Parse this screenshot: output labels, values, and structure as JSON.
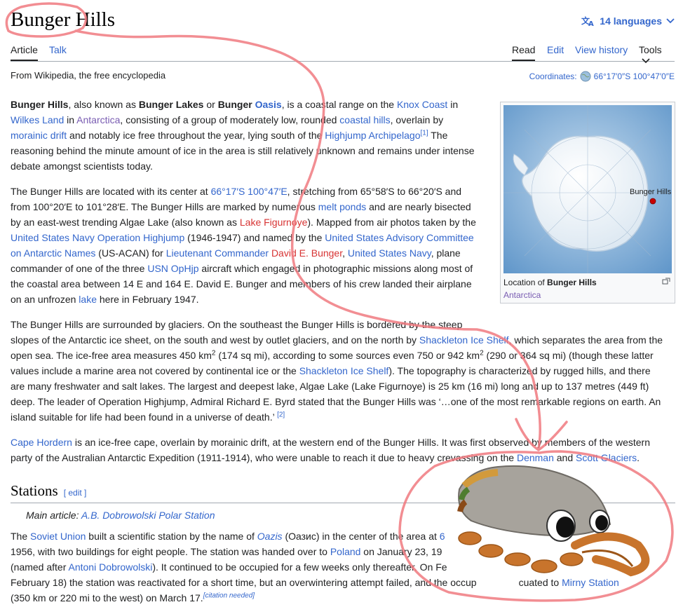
{
  "page": {
    "title": "Bunger Hills",
    "languages": "14 languages",
    "tabs_left": [
      "Article",
      "Talk"
    ],
    "tabs_right": [
      "Read",
      "Edit",
      "View history",
      "Tools"
    ],
    "from": "From Wikipedia, the free encyclopedia",
    "coords_label": "Coordinates:",
    "coords_value": "66°17′0″S 100°47′0″E"
  },
  "p1": {
    "b1": "Bunger Hills",
    "t1": ", also known as ",
    "b2": "Bunger Lakes",
    "t2": " or ",
    "b3": "Bunger ",
    "l_oasis": "Oasis",
    "t3": ", is a coastal range on the ",
    "l_knox": "Knox Coast",
    "t4": " in",
    "l_wilkes": "Wilkes Land",
    "t5": " in ",
    "l_antarctica": "Antarctica",
    "t6": ", consisting of a group of moderately low, rounded ",
    "l_coastal": "coastal hills",
    "t7": ", overlain by",
    "l_morainic": "morainic drift",
    "t8": " and notably ice free throughout the year, lying south of the ",
    "l_highjump": "Highjump Archipelago",
    "ref1": "[1]",
    "t9": " The",
    "line4": "reasoning behind the minute amount of ice in the area is still relatively unknown and remains under intense",
    "line5": "debate amongst scientists today."
  },
  "p2": {
    "t1": "The Bunger Hills are located with its center at ",
    "l_coord": "66°17′S 100°47′E",
    "t2": ", stretching from 65°58′S to 66°20′S and",
    "t3": "from 100°20′E to 101°28′E. The Bunger Hills are marked by numerous ",
    "l_melt": "melt ponds",
    "t4": " and are nearly bisected",
    "t5": "by an east-west trending Algae Lake (also known as ",
    "l_figurnoye": "Lake Figurnoye",
    "t6": "). Mapped from air photos taken by the",
    "l_usn": "United States Navy Operation Highjump",
    "t7": " (1946-1947) and named by the ",
    "l_usacan": "United States Advisory Committee",
    "l_usacan2": "on Antarctic Names",
    "t8": " (US-ACAN) for ",
    "l_ltcdr": "Lieutenant Commander",
    "t9": " ",
    "l_bunger": "David E. Bunger",
    "t10": ", ",
    "l_navy": "United States Navy",
    "t11": ", plane",
    "t12": "commander of one of the three ",
    "l_usnophjp": "USN OpHjp",
    "t13": " aircraft which engaged in photographic missions along most of",
    "line7": "the coastal area between 14 E and 164 E. David E. Bunger and members of his crew landed their airplane",
    "t14": "on an unfrozen ",
    "l_lake": "lake",
    "t15": " here in February 1947."
  },
  "p3": {
    "line1": "The Bunger Hills are surrounded by glaciers. On the southeast the Bunger Hills is bordered by the steep",
    "t1": "slopes of the Antarctic ice sheet, on the south and west by outlet glaciers, and on the north by ",
    "l_shackleton": "Shackleton Ice Shelf",
    "t2": ", which separates the area from the",
    "t3": "open sea. The ice-free area measures 450 km",
    "sup2": "2",
    "t4": " (174 sq mi), according to some sources even 750 or 942 km",
    "sup2b": "2",
    "t5": " (290 or 364 sq mi) (though these latter",
    "t6": "values include a marine area not covered by continental ice or the ",
    "l_shackleton2": "Shackleton Ice Shelf",
    "t7": "). The topography is characterized by rugged hills, and there",
    "line5": "are many freshwater and salt lakes. The largest and deepest lake, Algae Lake (Lake Figurnoye) is 25 km (16 mi) long and up to 137 metres (449 ft)",
    "line6": "deep. The leader of Operation Highjump, Admiral Richard E. Byrd stated that the Bunger Hills was ‘…one of the most remarkable regions on earth. An",
    "t8": "island suitable for life had been found in a universe of death.’ ",
    "ref2": "[2]"
  },
  "p4": {
    "l_cape": "Cape Hordern",
    "t1": " is an ice-free cape, overlain by morainic drift, at the western end of the Bunger Hills. It was first observed by members of the western",
    "t2": "party of the Australian Antarctic Expedition (1911-1914), who were unable to reach it due to heavy crevassing on the ",
    "l_denman": "Denman",
    "t3": " and ",
    "l_scott": "Scott Glaciers",
    "t4": "."
  },
  "stations": {
    "heading": "Stations",
    "edit": "[ edit ]",
    "hat_main": "Main article: ",
    "hat_link": "A.B. Dobrowolski Polar Station"
  },
  "p5": {
    "t1": "The ",
    "l_soviet": "Soviet Union",
    "t2": " built a scientific station by the name of ",
    "l_oazis": "Oazis",
    "t3": " (Оазис) in the center of the area at ",
    "l_6": "6",
    "t4": "1956, with two buildings for eight people. The station was handed over to ",
    "l_poland": "Poland",
    "t5": " on January 23, 19",
    "t6": "(named after ",
    "l_antoni": "Antoni Dobrowolski",
    "t7": "). It continued to be occupied for a few weeks only thereafter. On Fe",
    "t8": "February 18) the station was reactivated for a short time, but an overwintering attempt failed, and the occup",
    "t9": "cuated to ",
    "l_mirny": "Mirny Station",
    "t10": "(350 km or 220 mi to the west) on March 17.",
    "cn": "[citation needed]"
  },
  "infobox": {
    "caption_pre": "Location of ",
    "caption_b": "Bunger Hills",
    "caption_link": "Antarctica",
    "marker_label": "Bunger Hills"
  }
}
